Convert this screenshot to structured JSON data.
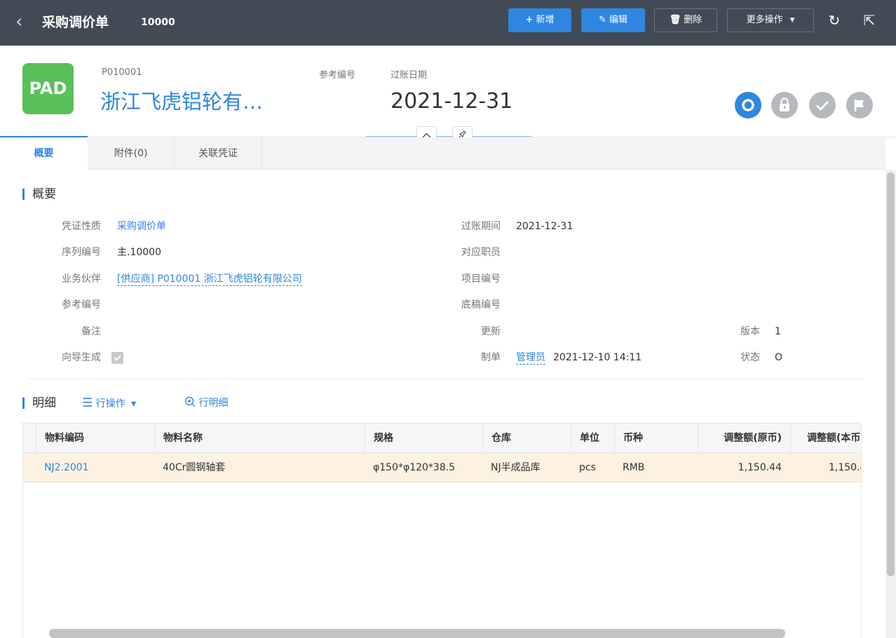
{
  "topbar": {
    "back_icon": "‹",
    "title": "采购调价单",
    "doc_number": "10000",
    "buttons": {
      "add": "新增",
      "edit": "编辑",
      "delete": "删除",
      "more": "更多操作"
    },
    "icons": {
      "add": "+",
      "edit": "✎",
      "delete": "🗑",
      "more_caret": "▾",
      "refresh": "↻",
      "export": "⇱"
    }
  },
  "header": {
    "logo_text": "PAD",
    "partner_code": "P010001",
    "partner_name": "浙江飞虎铝轮有…",
    "ref_label": "参考编号",
    "date_label": "过账日期",
    "date_value": "2021-12-31"
  },
  "tabs": [
    {
      "label": "概要"
    },
    {
      "label": "附件(0)"
    },
    {
      "label": "关联凭证"
    }
  ],
  "summary": {
    "heading": "概要",
    "fields": {
      "voucher_type": {
        "label": "凭证性质",
        "value": "采购调价单"
      },
      "serial_no": {
        "label": "序列编号",
        "value": "主.10000"
      },
      "partner": {
        "label": "业务伙伴",
        "value": "[供应商] P010001 浙江飞虎铝轮有限公司"
      },
      "ref_no": {
        "label": "参考编号",
        "value": ""
      },
      "remark": {
        "label": "备注",
        "value": ""
      },
      "wizard": {
        "label": "向导生成",
        "checked": true
      },
      "post_period": {
        "label": "过账期间",
        "value": "2021-12-31"
      },
      "staff": {
        "label": "对应职员",
        "value": ""
      },
      "project_no": {
        "label": "项目编号",
        "value": ""
      },
      "draft_no": {
        "label": "底稿编号",
        "value": ""
      },
      "update": {
        "label": "更新",
        "value": ""
      },
      "creator": {
        "label": "制单",
        "user": "管理员",
        "time": "2021-12-10 14:11"
      },
      "version": {
        "label": "版本",
        "value": "1"
      },
      "status": {
        "label": "状态",
        "value": "O"
      }
    }
  },
  "detail": {
    "heading": "明细",
    "row_ops_label": "行操作",
    "row_detail_label": "行明细",
    "columns": [
      "物料编码",
      "物料名称",
      "规格",
      "仓库",
      "单位",
      "币种",
      "调整额(原币)",
      "调整额(本币"
    ],
    "rows": [
      [
        "NJ2.2001",
        "40Cr圆钢轴套",
        "φ150*φ120*38.5",
        "NJ半成品库",
        "pcs",
        "RMB",
        "1,150.44",
        "1,150.4"
      ]
    ]
  },
  "colors": {
    "topbar_bg": "#424a55",
    "accent": "#2e86e0",
    "logo_bg": "#59c05b",
    "selected_row_bg": "#fdf2e1"
  }
}
